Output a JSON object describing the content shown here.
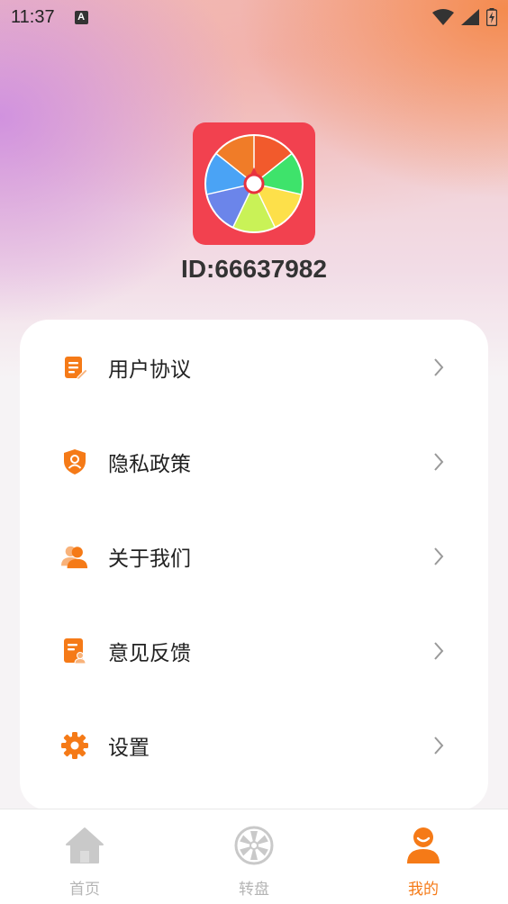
{
  "status_bar": {
    "time": "11:37",
    "notification_icon": "a-keyboard-icon",
    "icons": [
      "wifi-icon",
      "signal-icon",
      "battery-charging-icon"
    ]
  },
  "profile": {
    "logo_icon": "color-wheel-icon",
    "user_id": "ID:66637982"
  },
  "menu": {
    "items": [
      {
        "label": "用户协议",
        "icon": "document-edit-icon"
      },
      {
        "label": "隐私政策",
        "icon": "shield-user-icon"
      },
      {
        "label": "关于我们",
        "icon": "users-icon"
      },
      {
        "label": "意见反馈",
        "icon": "feedback-doc-icon"
      },
      {
        "label": "设置",
        "icon": "gear-icon"
      }
    ]
  },
  "bottom_nav": {
    "items": [
      {
        "label": "首页",
        "icon": "home-icon",
        "active": false
      },
      {
        "label": "转盘",
        "icon": "wheel-icon",
        "active": false
      },
      {
        "label": "我的",
        "icon": "person-icon",
        "active": true
      }
    ]
  },
  "colors": {
    "accent": "#f57a17",
    "logo_bg": "#f2414f",
    "inactive": "#b5b5b5"
  }
}
